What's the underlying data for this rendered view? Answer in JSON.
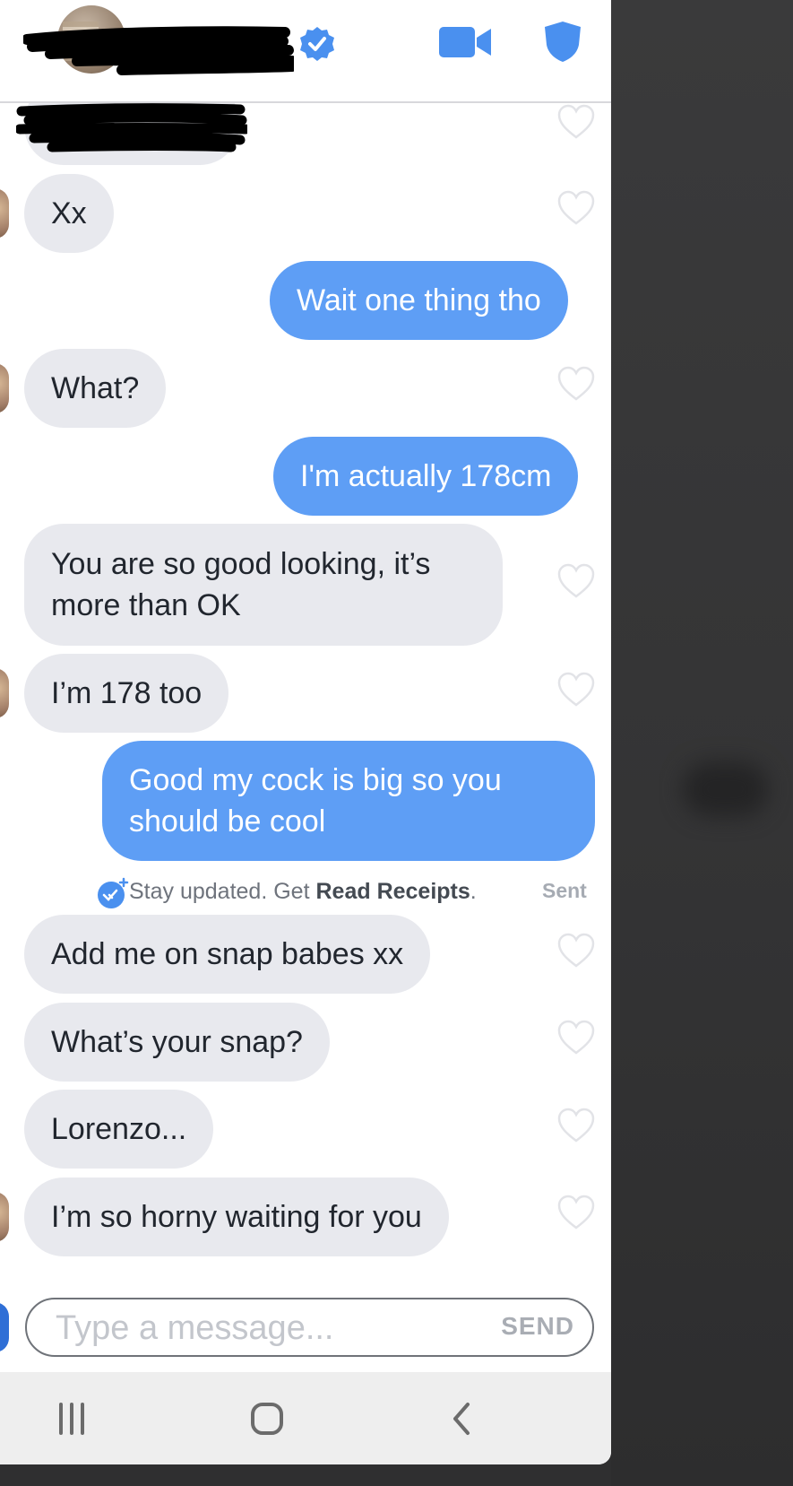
{
  "colors": {
    "outgoing_bubble": "#5e9ef5",
    "incoming_bubble": "#e8e9ee",
    "accent_blue": "#4a90ef",
    "background_dark": "#2f2f30"
  },
  "header": {
    "icons": [
      "verified-badge-icon",
      "video-call-icon",
      "shield-icon"
    ]
  },
  "messages": [
    {
      "from": "them",
      "text": "Xx"
    },
    {
      "from": "me",
      "text": "Wait one thing tho"
    },
    {
      "from": "them",
      "text": "What?"
    },
    {
      "from": "me",
      "text": "I'm actually 178cm"
    },
    {
      "from": "them",
      "text": "You are so good looking, it’s more than OK"
    },
    {
      "from": "them",
      "text": "I’m 178 too"
    },
    {
      "from": "me",
      "text": "Good my cock is big so you should be cool"
    },
    {
      "from": "them",
      "text": "Add me on snap babes xx"
    },
    {
      "from": "them",
      "text": "What’s your snap?"
    },
    {
      "from": "them",
      "text": "Lorenzo..."
    },
    {
      "from": "them",
      "text": "I’m so horny waiting for you"
    }
  ],
  "receipt": {
    "prefix": "Stay updated. Get ",
    "link": "Read Receipts",
    "suffix": ".",
    "status": "Sent"
  },
  "composer": {
    "placeholder": "Type a message...",
    "send_label": "SEND"
  },
  "navbar": {
    "icons": [
      "recent-apps-icon",
      "home-icon",
      "back-icon"
    ]
  }
}
